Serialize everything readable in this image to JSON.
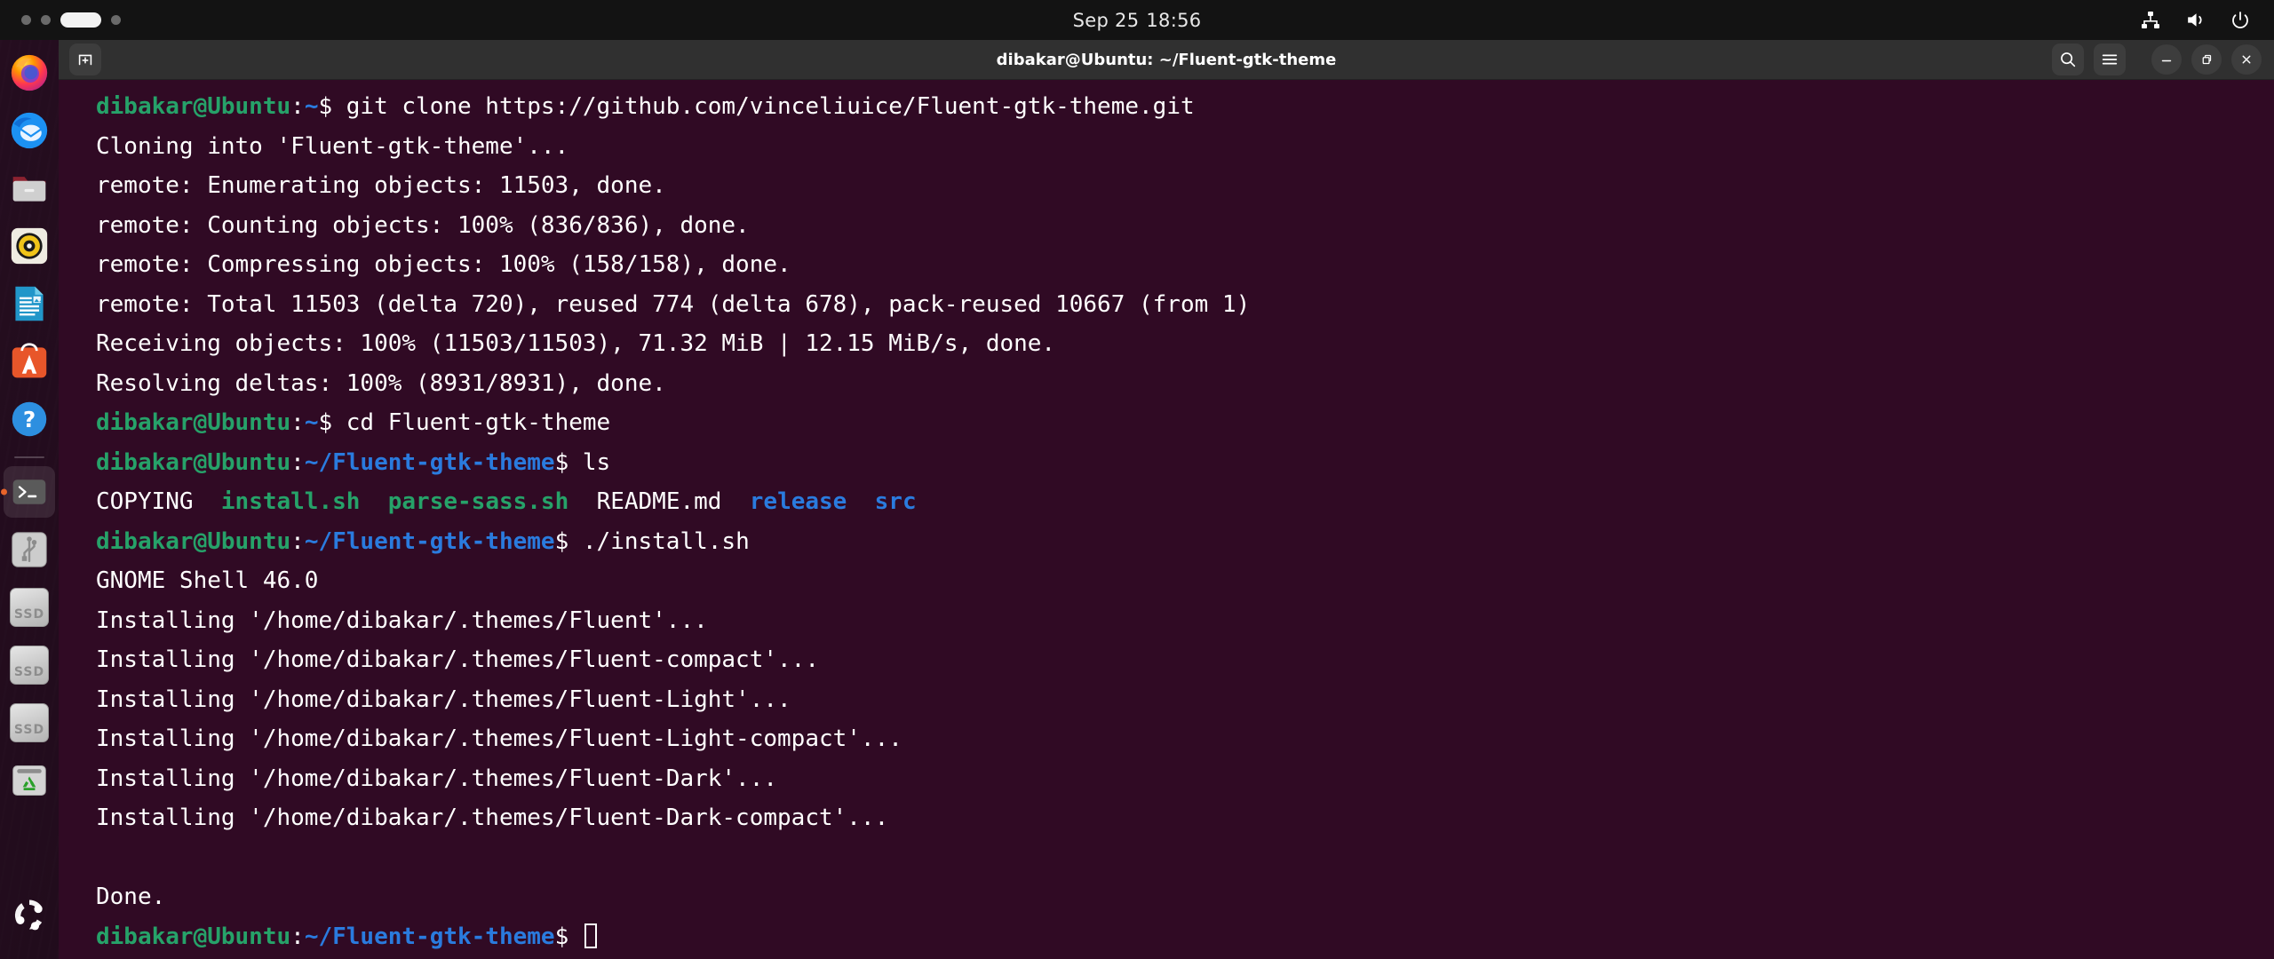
{
  "topbar": {
    "clock_date": "Sep 25",
    "clock_time": "18:56",
    "workspaces": [
      {
        "name": "workspace-1",
        "active": false
      },
      {
        "name": "workspace-2",
        "active": false
      },
      {
        "name": "workspace-3",
        "active": true
      },
      {
        "name": "workspace-4",
        "active": false
      }
    ],
    "tray": [
      {
        "icon": "network-icon",
        "label": "Network"
      },
      {
        "icon": "volume-icon",
        "label": "Volume"
      },
      {
        "icon": "power-icon",
        "label": "Power"
      }
    ]
  },
  "dock": {
    "items": [
      {
        "label": "Firefox Web Browser",
        "icon": "firefox-icon",
        "active": false
      },
      {
        "label": "Thunderbird Mail",
        "icon": "thunderbird-icon",
        "active": false
      },
      {
        "label": "Files",
        "icon": "files-icon",
        "active": false
      },
      {
        "label": "Rhythmbox",
        "icon": "rhythmbox-icon",
        "active": false
      },
      {
        "label": "LibreOffice Writer",
        "icon": "libreoffice-writer-icon",
        "active": false
      },
      {
        "label": "Ubuntu Software",
        "icon": "ubuntu-software-icon",
        "active": false
      },
      {
        "label": "Help",
        "icon": "help-icon",
        "active": false
      },
      {
        "label": "Terminal",
        "icon": "terminal-icon",
        "active": true
      },
      {
        "label": "USB Drive",
        "icon": "usb-drive-icon",
        "active": false
      },
      {
        "label": "SSD",
        "icon": "ssd-drive-icon",
        "active": false,
        "drive_label": "SSD"
      },
      {
        "label": "SSD",
        "icon": "ssd-drive-icon",
        "active": false,
        "drive_label": "SSD"
      },
      {
        "label": "SSD",
        "icon": "ssd-drive-icon",
        "active": false,
        "drive_label": "SSD"
      },
      {
        "label": "Trash",
        "icon": "trash-icon",
        "active": false
      }
    ],
    "show_applications": "show-applications-icon"
  },
  "window": {
    "title": "dibakar@Ubuntu: ~/Fluent-gtk-theme",
    "new_tab_label": "New Tab",
    "buttons": [
      {
        "name": "search-button",
        "icon": "search-icon"
      },
      {
        "name": "menu-button",
        "icon": "hamburger-icon"
      },
      {
        "name": "minimize-button",
        "icon": "minimize-icon"
      },
      {
        "name": "maximize-button",
        "icon": "maximize-icon"
      },
      {
        "name": "close-button",
        "icon": "close-icon"
      }
    ]
  },
  "terminal": {
    "prompt_user": "dibakar@Ubuntu",
    "prompt_home": "~",
    "prompt_path": "~/Fluent-gtk-theme",
    "prompt_sigil": "$",
    "commands": {
      "git_clone": " git clone https://github.com/vinceliuice/Fluent-gtk-theme.git",
      "cd": " cd Fluent-gtk-theme",
      "ls": " ls",
      "install": " ./install.sh"
    },
    "output": {
      "cloning": "Cloning into 'Fluent-gtk-theme'...",
      "enumerating": "remote: Enumerating objects: 11503, done.",
      "counting": "remote: Counting objects: 100% (836/836), done.",
      "compressing": "remote: Compressing objects: 100% (158/158), done.",
      "total": "remote: Total 11503 (delta 720), reused 774 (delta 678), pack-reused 10667 (from 1)",
      "receiving": "Receiving objects: 100% (11503/11503), 71.32 MiB | 12.15 MiB/s, done.",
      "resolving": "Resolving deltas: 100% (8931/8931), done.",
      "gnome_shell": "GNOME Shell 46.0",
      "install_1": "Installing '/home/dibakar/.themes/Fluent'...",
      "install_2": "Installing '/home/dibakar/.themes/Fluent-compact'...",
      "install_3": "Installing '/home/dibakar/.themes/Fluent-Light'...",
      "install_4": "Installing '/home/dibakar/.themes/Fluent-Light-compact'...",
      "install_5": "Installing '/home/dibakar/.themes/Fluent-Dark'...",
      "install_6": "Installing '/home/dibakar/.themes/Fluent-Dark-compact'...",
      "done": "Done."
    },
    "ls_output": [
      {
        "name": "COPYING",
        "color": "white"
      },
      {
        "name": "install.sh",
        "color": "green"
      },
      {
        "name": "parse-sass.sh",
        "color": "green"
      },
      {
        "name": "README.md",
        "color": "white"
      },
      {
        "name": "release",
        "color": "blue"
      },
      {
        "name": "src",
        "color": "blue"
      }
    ]
  },
  "colors": {
    "terminal_bg": "#300a24",
    "prompt_green": "#26a269",
    "path_blue": "#2a7bde",
    "topbar_bg": "#131313",
    "titlebar_bg": "#303030",
    "active_indicator": "#e8642a"
  }
}
